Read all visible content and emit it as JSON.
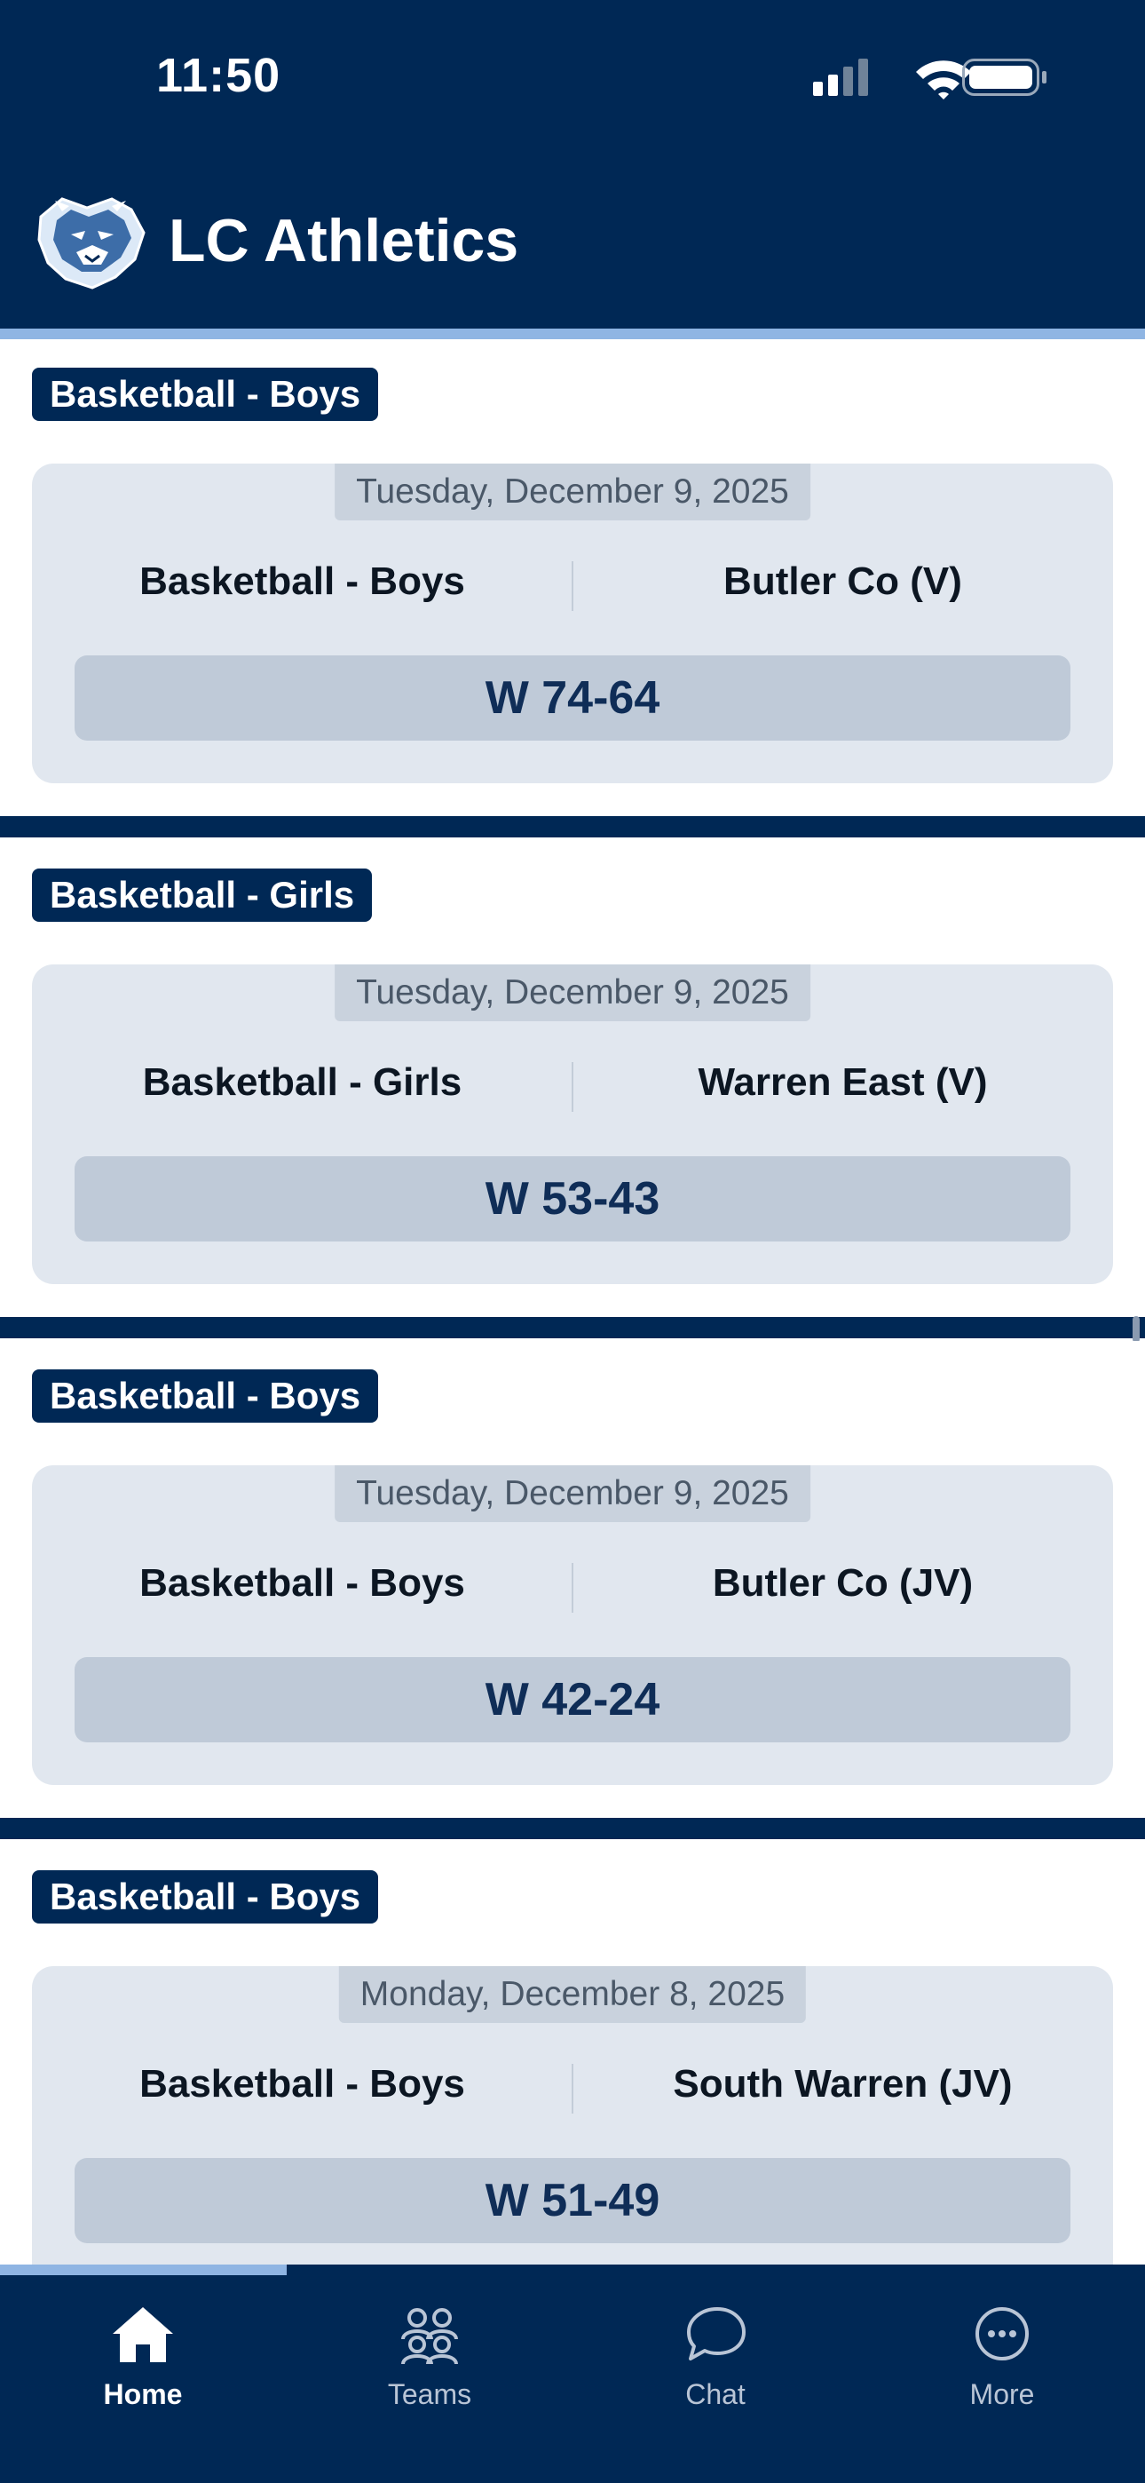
{
  "status_bar": {
    "time": "11:50"
  },
  "app": {
    "title": "LC Athletics"
  },
  "games": [
    {
      "sport": "Basketball - Boys",
      "date": "Tuesday, December 9, 2025",
      "home": "Basketball - Boys",
      "opponent": "Butler Co (V)",
      "result": "W 74-64"
    },
    {
      "sport": "Basketball - Girls",
      "date": "Tuesday, December 9, 2025",
      "home": "Basketball - Girls",
      "opponent": "Warren East (V)",
      "result": "W 53-43"
    },
    {
      "sport": "Basketball - Boys",
      "date": "Tuesday, December 9, 2025",
      "home": "Basketball - Boys",
      "opponent": "Butler Co (JV)",
      "result": "W 42-24"
    },
    {
      "sport": "Basketball - Boys",
      "date": "Monday, December 8, 2025",
      "home": "Basketball - Boys",
      "opponent": "South Warren (JV)",
      "result": "W 51-49"
    }
  ],
  "tabbar": {
    "items": [
      {
        "label": "Home",
        "icon": "home-icon",
        "active": true
      },
      {
        "label": "Teams",
        "icon": "teams-icon",
        "active": false
      },
      {
        "label": "Chat",
        "icon": "chat-icon",
        "active": false
      },
      {
        "label": "More",
        "icon": "more-icon",
        "active": false
      }
    ]
  },
  "colors": {
    "brand_navy": "#002855",
    "accent_light_blue": "#8fb5e3",
    "card_bg": "#e1e7ef",
    "result_bg": "#bfcad8"
  }
}
